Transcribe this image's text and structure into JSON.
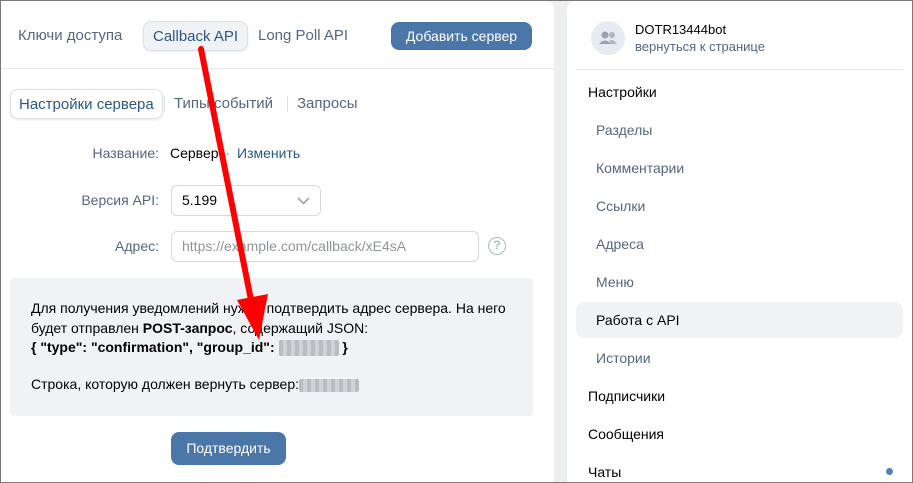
{
  "top_tabs": {
    "access_keys": "Ключи доступа",
    "callback_api": "Callback API",
    "long_poll_api": "Long Poll API",
    "add_server": "Добавить сервер"
  },
  "sub_tabs": {
    "server_settings": "Настройки сервера",
    "event_types": "Типы событий",
    "requests": "Запросы"
  },
  "form": {
    "name_label": "Название:",
    "name_value": "Сервер",
    "name_sep": "·",
    "change_link": "Изменить",
    "api_version_label": "Версия API:",
    "api_version_value": "5.199",
    "address_label": "Адрес:",
    "address_placeholder": "https://example.com/callback/xE4sA",
    "help_symbol": "?"
  },
  "info": {
    "line1": "Для получения уведомлений нужно подтвердить адрес сервера. На него",
    "line2_prefix": "будет отправлен ",
    "line2_bold": "POST-запрос",
    "line2_suffix": ", содержащий JSON:",
    "line3_prefix": "{ \"type\": \"confirmation\", \"group_id\": ",
    "line3_suffix": " }",
    "line4": "Строка, которую должен вернуть сервер:"
  },
  "confirm_button": "Подтвердить",
  "sidebar": {
    "bot_name": "DOTR13444bot",
    "back_link": "вернуться к странице",
    "items": [
      {
        "label": "Настройки"
      },
      {
        "label": "Разделы"
      },
      {
        "label": "Комментарии"
      },
      {
        "label": "Ссылки"
      },
      {
        "label": "Адреса"
      },
      {
        "label": "Меню"
      },
      {
        "label": "Работа с API"
      },
      {
        "label": "Истории"
      },
      {
        "label": "Подписчики"
      },
      {
        "label": "Сообщения"
      },
      {
        "label": "Чаты"
      }
    ]
  },
  "colors": {
    "accent": "#4a76a8",
    "annotation_arrow": "#ff0000"
  }
}
